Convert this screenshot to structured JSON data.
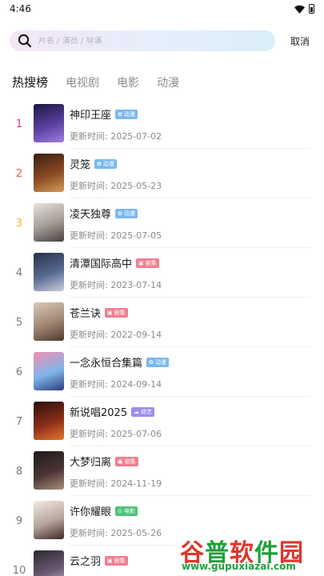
{
  "status": {
    "time": "4:46"
  },
  "search": {
    "placeholder": "片名 / 演员 / 导演",
    "cancel_label": "取消"
  },
  "tabs": [
    {
      "label": "热搜榜",
      "active": true
    },
    {
      "label": "电视剧",
      "active": false
    },
    {
      "label": "电影",
      "active": false
    },
    {
      "label": "动漫",
      "active": false
    }
  ],
  "list": {
    "items": [
      {
        "rank": "1",
        "rank_color": "#e0348b",
        "title": "神印王座",
        "badge": "动漫",
        "badge_type": "anime",
        "updated": "更新时间: 2025-07-02",
        "poster_colors": [
          "#1b1742",
          "#5a3f9e",
          "#a07de0"
        ]
      },
      {
        "rank": "2",
        "rank_color": "#f0594d",
        "title": "灵笼",
        "badge": "动漫",
        "badge_type": "anime",
        "updated": "更新时间: 2025-05-23",
        "poster_colors": [
          "#3a1d14",
          "#8a4a22",
          "#d29b57"
        ]
      },
      {
        "rank": "3",
        "rank_color": "#f2b235",
        "title": "凌天独尊",
        "badge": "动漫",
        "badge_type": "anime",
        "updated": "更新时间: 2025-07-05",
        "poster_colors": [
          "#e8e3de",
          "#a39a93",
          "#4a4244"
        ]
      },
      {
        "rank": "4",
        "rank_color": "#7a7a7a",
        "title": "清潭国际高中",
        "badge": "剧集",
        "badge_type": "drama",
        "updated": "更新时间: 2023-07-14",
        "poster_colors": [
          "#26304a",
          "#5a6a92",
          "#c9cde0"
        ]
      },
      {
        "rank": "5",
        "rank_color": "#7a7a7a",
        "title": "苍兰诀",
        "badge": "剧集",
        "badge_type": "drama",
        "updated": "更新时间: 2022-09-14",
        "poster_colors": [
          "#d9c9b8",
          "#9e8572",
          "#4b3a30"
        ]
      },
      {
        "rank": "6",
        "rank_color": "#7a7a7a",
        "title": "一念永恒合集篇",
        "badge": "动漫",
        "badge_type": "anime",
        "updated": "更新时间: 2024-09-14",
        "poster_colors": [
          "#f28fb2",
          "#7fb5ea",
          "#2d3d7a"
        ]
      },
      {
        "rank": "7",
        "rank_color": "#7a7a7a",
        "title": "新说唱2025",
        "badge": "综艺",
        "badge_type": "variety",
        "updated": "更新时间: 2025-07-06",
        "poster_colors": [
          "#2a0f0a",
          "#8a2e18",
          "#e8732c"
        ]
      },
      {
        "rank": "8",
        "rank_color": "#7a7a7a",
        "title": "大梦归离",
        "badge": "剧集",
        "badge_type": "drama",
        "updated": "更新时间: 2024-11-19",
        "poster_colors": [
          "#1e1a1a",
          "#4a3434",
          "#a88f7a"
        ]
      },
      {
        "rank": "9",
        "rank_color": "#7a7a7a",
        "title": "许你耀眼",
        "badge": "电影",
        "badge_type": "movie",
        "updated": "更新时间: 2025-05-26",
        "poster_colors": [
          "#f2ebe6",
          "#b6a39a",
          "#3d2a2a"
        ]
      },
      {
        "rank": "10",
        "rank_color": "#7a7a7a",
        "title": "云之羽",
        "badge": "剧集",
        "badge_type": "drama",
        "updated": "",
        "poster_colors": [
          "#2c2830",
          "#6b5a72",
          "#cfc1d4"
        ]
      }
    ]
  },
  "watermark": {
    "chars": [
      "谷",
      "普",
      "软",
      "件",
      "园"
    ],
    "url": "www.gupuxiazai.com",
    "colors": [
      "#e0342a",
      "#1e9f3a",
      "#e0342a",
      "#1e9f3a",
      "#e0342a"
    ]
  },
  "badge_icons": {
    "anime": "✿",
    "drama": "▣",
    "variety": "☁",
    "movie": "⊙"
  }
}
